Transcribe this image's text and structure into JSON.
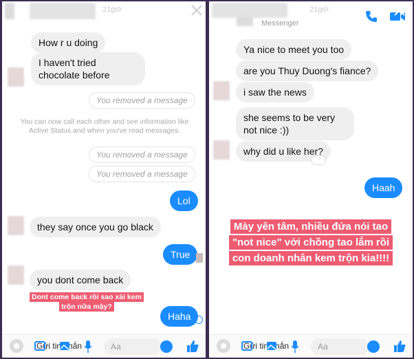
{
  "left": {
    "header": {
      "time": "21giờ"
    },
    "messages": [
      {
        "text": "How r u doing"
      },
      {
        "text": "I haven't tried chocolate before"
      },
      {
        "removed": "You removed a message"
      },
      {
        "system": "You can now call each other and see information like Active Status and when you've read messages."
      },
      {
        "removed": "You removed a message"
      },
      {
        "removed": "You removed a message"
      },
      {
        "text": "Lol",
        "me": true
      },
      {
        "text": "they say once you go black"
      },
      {
        "text": "True",
        "me": true
      },
      {
        "text": "you dont come back"
      },
      {
        "text": "Haha",
        "me": true
      }
    ],
    "caption": "Dont come back rồi sao xài kem trộn nữa mậy?",
    "composer": {
      "placeholder": "Gửi tin nhắn",
      "input": "Aa"
    }
  },
  "right": {
    "header": {
      "time": "21giờ",
      "subtitle": "Messenger"
    },
    "messages": [
      {
        "text": "Ya nice to meet you too"
      },
      {
        "text": "are you Thuy Duong's fiance?"
      },
      {
        "text": "i saw the news"
      },
      {
        "text": "she seems to be very not nice :))"
      },
      {
        "text": "why did u like her?"
      },
      {
        "text": "Haah",
        "me": true
      }
    ],
    "caption": "Mày yên tâm, nhiều đứa nói tao \"not nice\" với chồng tao lắm rồi con doanh nhân kem trộn kia!!!!",
    "composer": {
      "placeholder": "Gửi tin nhắn",
      "input": "Aa"
    }
  },
  "colors": {
    "accent": "#1a8cff",
    "caption_bg": "#ee5c72",
    "frame": "#3d2d52"
  }
}
